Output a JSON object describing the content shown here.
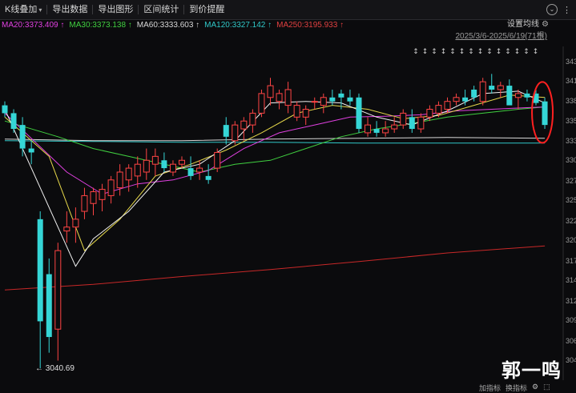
{
  "toolbar": {
    "items": [
      "K线叠加",
      "导出数据",
      "导出图形",
      "区间统计",
      "到价提醒"
    ],
    "close_symbol": "⌄"
  },
  "ma_legend": [
    {
      "label": "MA20:3373.409",
      "color": "#e040e0"
    },
    {
      "label": "MA30:3373.138",
      "color": "#40d040"
    },
    {
      "label": "MA60:3333.603",
      "color": "#d8d8d8"
    },
    {
      "label": "MA120:3327.142",
      "color": "#30c8c8"
    },
    {
      "label": "MA250:3195.933",
      "color": "#e04040"
    }
  ],
  "settings_label": "设置均线",
  "range_label": "2025/3/6-2025/6/19(71根)",
  "low_label": "3040.69",
  "watermark": "郭一鸣",
  "bottom": {
    "add": "加指标",
    "switch": "换指标"
  },
  "colors": {
    "up": "#ff4444",
    "down": "#35d6d6",
    "ma5": "#f0f0f0",
    "ma10": "#e6d84a",
    "ma20": "#e040e0",
    "ma30": "#40d040",
    "ma60": "#d8d8d8",
    "ma120": "#30c8c8",
    "ma250": "#c82828"
  },
  "chart_data": {
    "type": "candlestick",
    "ylim": [
      3025,
      3450
    ],
    "y_ticks": [
      {
        "text": "343",
        "value": 3430
      },
      {
        "text": "341",
        "value": 3405
      },
      {
        "text": "338",
        "value": 3380
      },
      {
        "text": "335",
        "value": 3354
      },
      {
        "text": "333",
        "value": 3329
      },
      {
        "text": "330",
        "value": 3304
      },
      {
        "text": "327",
        "value": 3278
      },
      {
        "text": "325",
        "value": 3253
      },
      {
        "text": "322",
        "value": 3227
      },
      {
        "text": "320",
        "value": 3202
      },
      {
        "text": "317",
        "value": 3176
      },
      {
        "text": "314",
        "value": 3151
      },
      {
        "text": "312",
        "value": 3125
      },
      {
        "text": "309",
        "value": 3100
      },
      {
        "text": "306",
        "value": 3074
      },
      {
        "text": "304",
        "value": 3049
      }
    ],
    "candles": [
      [
        3375,
        3380,
        3360,
        3365
      ],
      [
        3365,
        3370,
        3340,
        3345
      ],
      [
        3350,
        3360,
        3310,
        3320
      ],
      [
        3320,
        3330,
        3300,
        3315
      ],
      [
        3230,
        3240,
        3040,
        3100
      ],
      [
        3160,
        3180,
        3060,
        3080
      ],
      [
        3090,
        3200,
        3050,
        3190
      ],
      [
        3215,
        3240,
        3200,
        3220
      ],
      [
        3220,
        3245,
        3200,
        3230
      ],
      [
        3240,
        3270,
        3230,
        3260
      ],
      [
        3250,
        3270,
        3235,
        3265
      ],
      [
        3255,
        3275,
        3240,
        3268
      ],
      [
        3260,
        3285,
        3250,
        3280
      ],
      [
        3270,
        3300,
        3260,
        3290
      ],
      [
        3280,
        3300,
        3265,
        3295
      ],
      [
        3285,
        3310,
        3270,
        3300
      ],
      [
        3290,
        3320,
        3280,
        3305
      ],
      [
        3300,
        3320,
        3285,
        3310
      ],
      [
        3305,
        3315,
        3290,
        3295
      ],
      [
        3290,
        3305,
        3285,
        3300
      ],
      [
        3300,
        3310,
        3295,
        3305
      ],
      [
        3295,
        3310,
        3280,
        3285
      ],
      [
        3290,
        3305,
        3280,
        3295
      ],
      [
        3285,
        3300,
        3275,
        3280
      ],
      [
        3295,
        3320,
        3290,
        3315
      ],
      [
        3350,
        3360,
        3325,
        3335
      ],
      [
        3330,
        3355,
        3325,
        3350
      ],
      [
        3345,
        3360,
        3330,
        3355
      ],
      [
        3350,
        3370,
        3340,
        3365
      ],
      [
        3365,
        3395,
        3360,
        3390
      ],
      [
        3385,
        3410,
        3375,
        3400
      ],
      [
        3380,
        3395,
        3370,
        3390
      ],
      [
        3375,
        3405,
        3365,
        3395
      ],
      [
        3360,
        3380,
        3355,
        3375
      ],
      [
        3360,
        3375,
        3350,
        3370
      ],
      [
        3380,
        3385,
        3370,
        3380
      ],
      [
        3375,
        3390,
        3365,
        3385
      ],
      [
        3385,
        3395,
        3375,
        3380
      ],
      [
        3390,
        3395,
        3370,
        3385
      ],
      [
        3385,
        3395,
        3375,
        3380
      ],
      [
        3385,
        3390,
        3340,
        3345
      ],
      [
        3340,
        3360,
        3335,
        3350
      ],
      [
        3345,
        3355,
        3335,
        3340
      ],
      [
        3340,
        3355,
        3335,
        3345
      ],
      [
        3345,
        3360,
        3340,
        3350
      ],
      [
        3350,
        3370,
        3345,
        3365
      ],
      [
        3360,
        3370,
        3340,
        3345
      ],
      [
        3345,
        3365,
        3340,
        3360
      ],
      [
        3360,
        3375,
        3355,
        3370
      ],
      [
        3365,
        3380,
        3360,
        3375
      ],
      [
        3370,
        3385,
        3365,
        3380
      ],
      [
        3380,
        3390,
        3375,
        3385
      ],
      [
        3385,
        3395,
        3375,
        3380
      ],
      [
        3395,
        3400,
        3380,
        3385
      ],
      [
        3380,
        3410,
        3375,
        3405
      ],
      [
        3400,
        3415,
        3390,
        3395
      ],
      [
        3395,
        3405,
        3385,
        3400
      ],
      [
        3400,
        3408,
        3380,
        3375
      ],
      [
        3385,
        3395,
        3370,
        3390
      ],
      [
        3390,
        3395,
        3380,
        3385
      ],
      [
        3390,
        3395,
        3375,
        3378
      ],
      [
        3380,
        3385,
        3345,
        3350
      ]
    ],
    "ma_series": {
      "ma5": [
        [
          0,
          3370
        ],
        [
          4,
          3270
        ],
        [
          8,
          3170
        ],
        [
          10,
          3205
        ],
        [
          14,
          3240
        ],
        [
          18,
          3290
        ],
        [
          22,
          3300
        ],
        [
          26,
          3330
        ],
        [
          30,
          3378
        ],
        [
          34,
          3380
        ],
        [
          38,
          3378
        ],
        [
          42,
          3360
        ],
        [
          46,
          3350
        ],
        [
          50,
          3368
        ],
        [
          54,
          3390
        ],
        [
          58,
          3393
        ],
        [
          61,
          3378
        ]
      ],
      "ma10": [
        [
          0,
          3360
        ],
        [
          5,
          3310
        ],
        [
          9,
          3190
        ],
        [
          13,
          3230
        ],
        [
          17,
          3285
        ],
        [
          21,
          3300
        ],
        [
          25,
          3318
        ],
        [
          29,
          3340
        ],
        [
          33,
          3365
        ],
        [
          37,
          3375
        ],
        [
          41,
          3370
        ],
        [
          45,
          3358
        ],
        [
          49,
          3362
        ],
        [
          53,
          3375
        ],
        [
          57,
          3388
        ],
        [
          61,
          3385
        ]
      ],
      "ma20": [
        [
          0,
          3365
        ],
        [
          7,
          3290
        ],
        [
          11,
          3262
        ],
        [
          15,
          3275
        ],
        [
          19,
          3280
        ],
        [
          23,
          3292
        ],
        [
          27,
          3320
        ],
        [
          31,
          3340
        ],
        [
          35,
          3350
        ],
        [
          39,
          3360
        ],
        [
          43,
          3361
        ],
        [
          47,
          3363
        ],
        [
          51,
          3368
        ],
        [
          55,
          3370
        ],
        [
          59,
          3372
        ],
        [
          61,
          3373
        ]
      ],
      "ma30": [
        [
          0,
          3355
        ],
        [
          6,
          3335
        ],
        [
          10,
          3320
        ],
        [
          14,
          3310
        ],
        [
          18,
          3300
        ],
        [
          22,
          3290
        ],
        [
          26,
          3300
        ],
        [
          30,
          3305
        ],
        [
          34,
          3320
        ],
        [
          38,
          3335
        ],
        [
          42,
          3345
        ],
        [
          46,
          3352
        ],
        [
          50,
          3360
        ],
        [
          54,
          3365
        ],
        [
          58,
          3370
        ],
        [
          61,
          3373
        ]
      ],
      "ma60": [
        [
          0,
          3332
        ],
        [
          10,
          3330
        ],
        [
          20,
          3330
        ],
        [
          30,
          3332
        ],
        [
          40,
          3333
        ],
        [
          50,
          3334
        ],
        [
          61,
          3333
        ]
      ],
      "ma120": [
        [
          0,
          3330
        ],
        [
          10,
          3329
        ],
        [
          20,
          3328
        ],
        [
          30,
          3328
        ],
        [
          40,
          3327
        ],
        [
          50,
          3327
        ],
        [
          61,
          3327
        ]
      ],
      "ma250": [
        [
          0,
          3140
        ],
        [
          10,
          3147
        ],
        [
          20,
          3157
        ],
        [
          30,
          3166
        ],
        [
          40,
          3176
        ],
        [
          50,
          3187
        ],
        [
          61,
          3196
        ]
      ]
    }
  }
}
